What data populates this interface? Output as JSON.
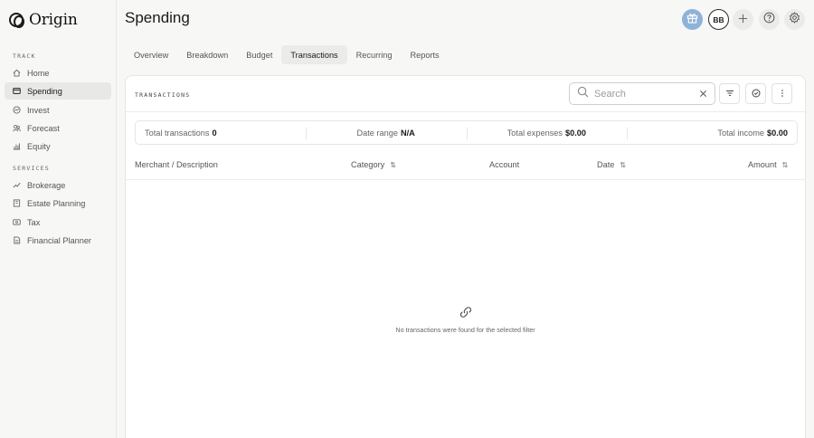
{
  "app": {
    "name": "Origin"
  },
  "sidebar": {
    "sections": [
      {
        "title": "Track",
        "items": [
          {
            "label": "Home",
            "icon": "home-icon"
          },
          {
            "label": "Spending",
            "icon": "wallet-icon",
            "active": true
          },
          {
            "label": "Invest",
            "icon": "invest-icon"
          },
          {
            "label": "Forecast",
            "icon": "forecast-icon"
          },
          {
            "label": "Equity",
            "icon": "equity-icon"
          }
        ]
      },
      {
        "title": "Services",
        "items": [
          {
            "label": "Brokerage",
            "icon": "trend-icon"
          },
          {
            "label": "Estate Planning",
            "icon": "building-icon"
          },
          {
            "label": "Tax",
            "icon": "tax-icon"
          },
          {
            "label": "Financial Planner",
            "icon": "document-icon"
          }
        ]
      }
    ]
  },
  "header": {
    "title": "Spending",
    "avatar_initials": "BB"
  },
  "tabs": [
    {
      "label": "Overview"
    },
    {
      "label": "Breakdown"
    },
    {
      "label": "Budget"
    },
    {
      "label": "Transactions",
      "active": true
    },
    {
      "label": "Recurring"
    },
    {
      "label": "Reports"
    }
  ],
  "panel": {
    "title": "Transactions",
    "search": {
      "placeholder": "Search",
      "value": ""
    },
    "summary": {
      "total_transactions_label": "Total transactions",
      "total_transactions_value": "0",
      "date_range_label": "Date range",
      "date_range_value": "N/A",
      "total_expenses_label": "Total expenses",
      "total_expenses_value": "$0.00",
      "total_income_label": "Total income",
      "total_income_value": "$0.00"
    },
    "columns": {
      "merchant": "Merchant / Description",
      "category": "Category",
      "account": "Account",
      "date": "Date",
      "amount": "Amount"
    },
    "empty_message": "No transactions were found for the selected filter"
  },
  "colors": {
    "accent_gift": "#8fb2d8",
    "active_bg": "#e8e8e7"
  }
}
